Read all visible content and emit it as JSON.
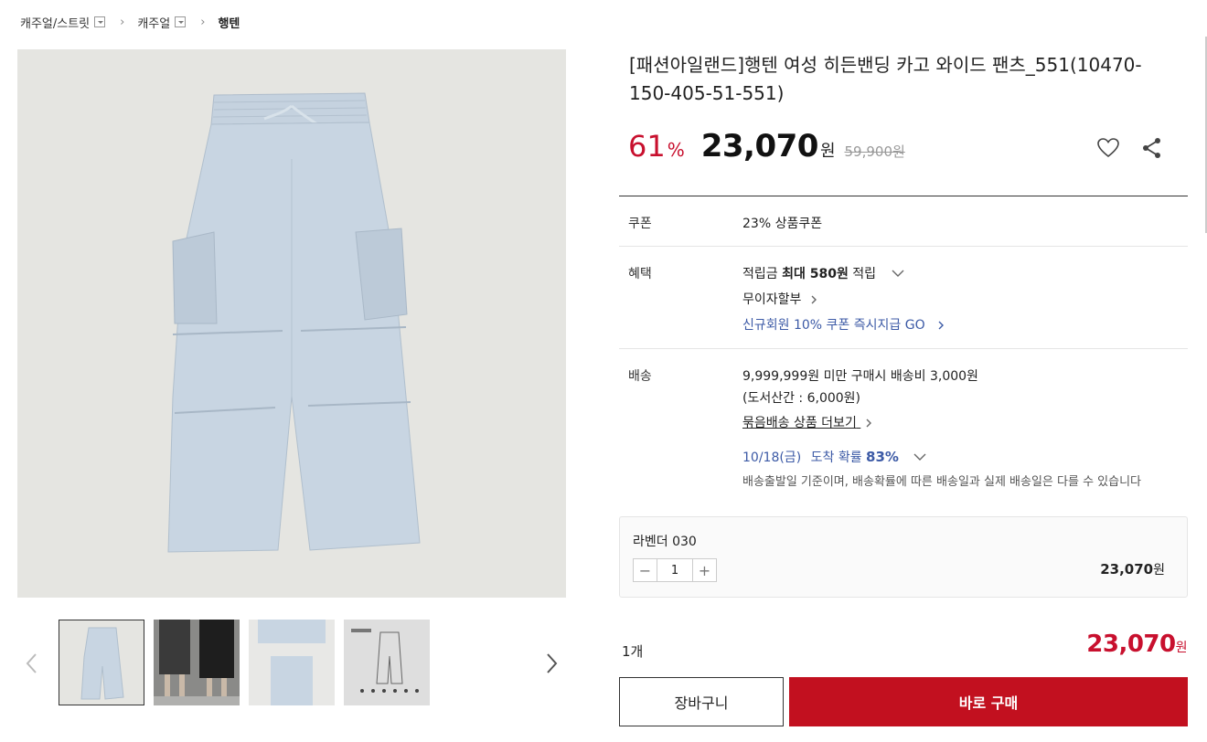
{
  "breadcrumb": {
    "items": [
      "캐주얼/스트릿",
      "캐주얼"
    ],
    "current": "행텐",
    "sep": "›"
  },
  "product": {
    "title": "[패션아일랜드]행텐 여성 히든밴딩 카고 와이드 팬츠_551(10470-150-405-51-551)",
    "discount": "61",
    "discount_unit": "%",
    "price": "23,070",
    "won": "원",
    "original_price": "59,900원"
  },
  "info": {
    "coupon_label": "쿠폰",
    "coupon_value": "23% 상품쿠폰",
    "benefit_label": "혜택",
    "benefit_points_prefix": "적립금",
    "benefit_points_bold": "최대 580원",
    "benefit_points_suffix": "적립",
    "benefit_installment": "무이자할부",
    "benefit_new_member": "신규회원 10% 쿠폰 즉시지급 GO",
    "shipping_label": "배송",
    "shipping_line1": "9,999,999원 미만 구매시 배송비 3,000원",
    "shipping_line2": "(도서산간 : 6,000원)",
    "shipping_bundle": "묶음배송 상품 더보기",
    "arrival_date": "10/18(금)",
    "arrival_text": "도착 확률",
    "arrival_prob": "83%",
    "arrival_note": "배송출발일 기준이며, 배송확률에 따른 배송일과 실제 배송일은 다를 수 있습니다"
  },
  "option": {
    "name": "라벤더 030",
    "quantity": "1",
    "price": "23,070",
    "won": "원"
  },
  "summary": {
    "count": "1개",
    "total": "23,070",
    "won": "원"
  },
  "buttons": {
    "cart": "장바구니",
    "buy": "바로 구매"
  },
  "colors": {
    "accent": "#c8102e",
    "link": "#3c5aa6"
  },
  "icons": [
    "dropdown-icon",
    "heart-icon",
    "share-icon",
    "chevron-right-icon",
    "chevron-down-icon",
    "arrow-left-icon",
    "arrow-right-icon"
  ]
}
